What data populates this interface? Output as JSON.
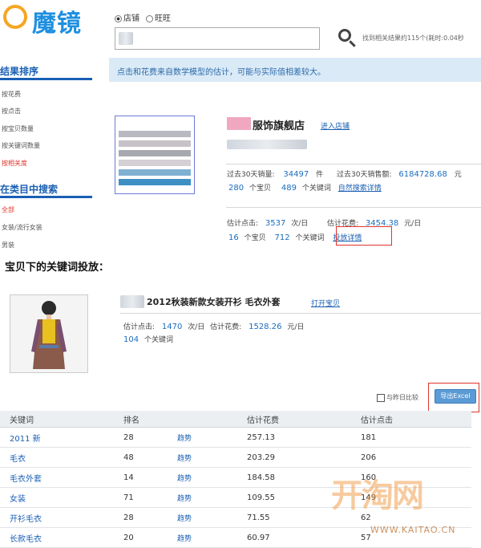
{
  "header": {
    "logo": "魔镜",
    "radio_options": [
      {
        "label": "店铺",
        "selected": true
      },
      {
        "label": "旺旺",
        "selected": false
      }
    ],
    "result_count": "找到相关结果约115个(耗时:0.04秒"
  },
  "sidebar": {
    "sort_title": "结果排序",
    "sort_items": [
      "按花费",
      "按点击",
      "按宝贝数量",
      "按关键词数量",
      "按相关度"
    ],
    "category_title": "在类目中搜索",
    "category_items": [
      "全部",
      "女装/流行女装",
      "男装"
    ]
  },
  "notice": "点击和花费来自数学模型的估计，可能与实际值相差较大。",
  "shop": {
    "name": "服饰旗舰店",
    "enter_link": "进入店铺",
    "sales_label": "过去30天销量:",
    "sales_value": "34497",
    "sales_unit": "件",
    "revenue_label": "过去30天销售额:",
    "revenue_value": "6184728.68",
    "revenue_unit": "元",
    "items_value": "280",
    "items_unit": "个宝贝",
    "keywords_value": "489",
    "keywords_unit": "个关键词",
    "natural_search_link": "自然搜索详情",
    "est_clicks_label": "估计点击:",
    "est_clicks_value": "3537",
    "est_clicks_unit": "次/日",
    "est_cost_label": "估计花费:",
    "est_cost_value": "3454.38",
    "est_cost_unit": "元/日",
    "ad_items_value": "16",
    "ad_items_unit": "个宝贝",
    "ad_keywords_value": "712",
    "ad_keywords_unit": "个关键词",
    "ad_detail_link": "投放详情"
  },
  "section_title": "宝贝下的关键词投放：",
  "item": {
    "title": "2012秋装新款女装开衫 毛衣外套",
    "open_link": "打开宝贝",
    "est_clicks_label": "估计点击:",
    "est_clicks_value": "1470",
    "est_clicks_unit": "次/日",
    "est_cost_label": "估计花费:",
    "est_cost_value": "1528.26",
    "est_cost_unit": "元/日",
    "keywords_value": "104",
    "keywords_unit": "个关键词"
  },
  "compare_label": "与昨日比较",
  "export_label": "导出Excel",
  "table": {
    "headers": [
      "关键词",
      "排名",
      "",
      "估计花费",
      "估计点击"
    ],
    "rows": [
      {
        "keyword": "2011 新",
        "rank": "28",
        "trend": "趋势",
        "cost": "257.13",
        "clicks": "181"
      },
      {
        "keyword": "毛衣",
        "rank": "48",
        "trend": "趋势",
        "cost": "203.29",
        "clicks": "206"
      },
      {
        "keyword": "毛衣外套",
        "rank": "14",
        "trend": "趋势",
        "cost": "184.58",
        "clicks": "160"
      },
      {
        "keyword": "女装",
        "rank": "71",
        "trend": "趋势",
        "cost": "109.55",
        "clicks": "149"
      },
      {
        "keyword": "开衫毛衣",
        "rank": "28",
        "trend": "趋势",
        "cost": "71.55",
        "clicks": "62"
      },
      {
        "keyword": "长款毛衣",
        "rank": "20",
        "trend": "趋势",
        "cost": "60.97",
        "clicks": "57"
      }
    ]
  },
  "watermark": {
    "logo": "开淘网",
    "url": "WWW.KAITAO.CN"
  }
}
